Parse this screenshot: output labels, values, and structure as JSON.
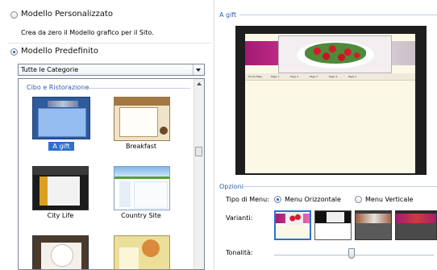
{
  "left": {
    "custom_label": "Modello Personalizzato",
    "custom_desc": "Crea da zero il Modello grafico per il Sito.",
    "predefined_label": "Modello Predefinito",
    "category_select": "Tutte le Categorie",
    "group_title": "Cibo e Ristorazione",
    "templates": [
      {
        "name": "A gift",
        "selected": true
      },
      {
        "name": "Breakfast",
        "selected": false
      },
      {
        "name": "City Life",
        "selected": false
      },
      {
        "name": "Country Site",
        "selected": false
      },
      {
        "name": "",
        "selected": false
      },
      {
        "name": "",
        "selected": false
      }
    ]
  },
  "right": {
    "preview_title": "A gift",
    "nav_items": [
      "Home Page",
      "Page 1",
      "Page 2",
      "Page 3",
      "Page 4",
      "Page 5"
    ],
    "options_title": "Opzioni",
    "menu_type_label": "Tipo di Menu:",
    "menu_horizontal": "Menu Orizzontale",
    "menu_vertical": "Menu Verticale",
    "variants_label": "Varianti:",
    "tone_label": "Tonalità:"
  },
  "colors": {
    "accent": "#2d5fa8",
    "selection": "#2f6fd0",
    "magenta": "#c01b7c"
  }
}
